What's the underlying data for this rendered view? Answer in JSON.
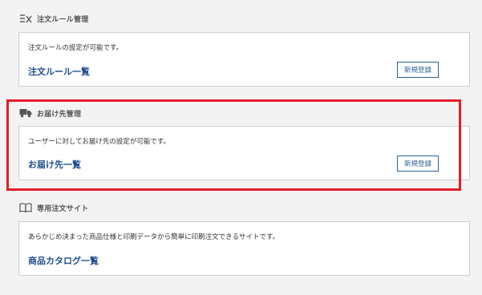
{
  "sections": [
    {
      "title": "注文ルール管理",
      "icon": "list-check-icon",
      "description": "注文ルールの設定が可能です。",
      "link": "注文ルール一覧",
      "button": "新規登録"
    },
    {
      "title": "お届け先管理",
      "icon": "truck-icon",
      "description": "ユーザーに対してお届け先の設定が可能です。",
      "link": "お届け先一覧",
      "button": "新規登録"
    },
    {
      "title": "専用注文サイト",
      "icon": "book-icon",
      "description": "あらかじめ決まった商品仕様と印刷データから簡単に印刷注文できるサイトです。",
      "link": "商品カタログ一覧"
    }
  ],
  "colors": {
    "background": "#f3f3f3",
    "card": "#ffffff",
    "link": "#1f4f8a",
    "button_border": "#2f5f95",
    "highlight": "#e11f26"
  }
}
